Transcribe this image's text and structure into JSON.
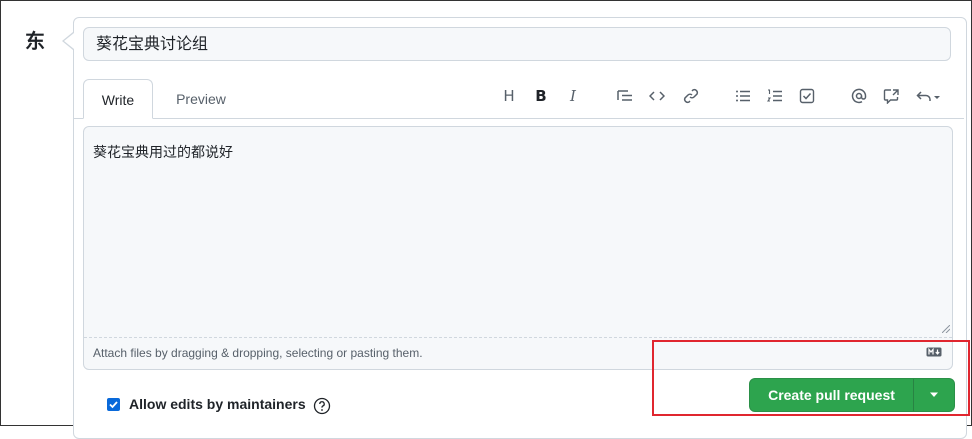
{
  "author": {
    "avatar_text": "东"
  },
  "title_field": {
    "value": "葵花宝典讨论组"
  },
  "tabs": [
    {
      "label": "Write",
      "active": true
    },
    {
      "label": "Preview",
      "active": false
    }
  ],
  "toolbar": {
    "heading": "H",
    "bold": "B",
    "italic": "I",
    "icons": [
      "heading-icon",
      "bold-icon",
      "italic-icon",
      "quote-icon",
      "code-icon",
      "link-icon",
      "unordered-list-icon",
      "ordered-list-icon",
      "task-list-icon",
      "mention-icon",
      "reference-icon",
      "reply-icon"
    ]
  },
  "editor": {
    "body_text": "葵花宝典用过的都说好",
    "attach_hint": "Attach files by dragging & dropping, selecting or pasting them."
  },
  "options": {
    "allow_edits_label": "Allow edits by maintainers",
    "allow_edits_checked": true
  },
  "actions": {
    "create_pr_label": "Create pull request"
  },
  "colors": {
    "accent_green": "#2da44e",
    "checkbox_blue": "#0969da",
    "highlight_red": "#e0262f"
  }
}
